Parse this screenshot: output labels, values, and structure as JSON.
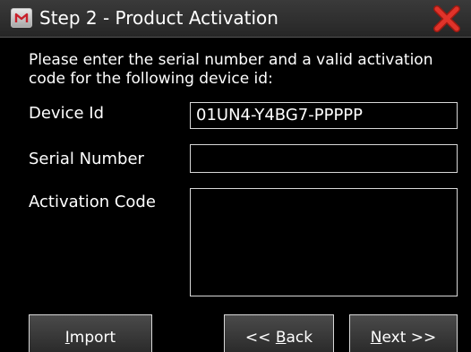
{
  "window": {
    "title": "Step 2 - Product Activation"
  },
  "prompt": "Please enter the serial number and a valid activation code for the following device id:",
  "fields": {
    "device_id": {
      "label": "Device Id",
      "value": "01UN4-Y4BG7-PPPPP"
    },
    "serial_number": {
      "label": "Serial Number",
      "value": ""
    },
    "activation_code": {
      "label": "Activation Code",
      "value": ""
    }
  },
  "buttons": {
    "import": {
      "mnemonic": "I",
      "rest": "mport"
    },
    "back": {
      "prefix": "<< ",
      "mnemonic": "B",
      "rest": "ack"
    },
    "next": {
      "mnemonic": "N",
      "rest": "ext >>"
    }
  },
  "colors": {
    "background": "#000000",
    "text": "#ffffff",
    "close_icon": "#e0332a"
  },
  "icons": {
    "app": "m-logo-icon",
    "close": "close-x-icon"
  }
}
